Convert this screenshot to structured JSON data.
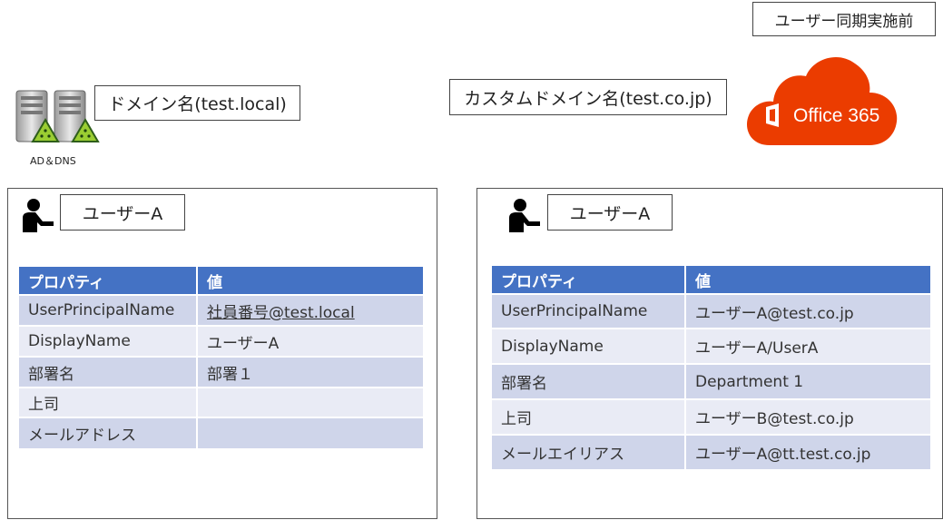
{
  "header": {
    "status_label": "ユーザー同期実施前"
  },
  "onprem": {
    "domain_label": "ドメイン名(test.local)",
    "server_caption": "AD＆DNS",
    "user_label": "ユーザーA",
    "table": {
      "columns": [
        "プロパティ",
        "値"
      ],
      "rows": [
        {
          "prop": "UserPrincipalName",
          "value": "社員番号@test.local"
        },
        {
          "prop": "DisplayName",
          "value": "ユーザーA"
        },
        {
          "prop": "部署名",
          "value": "部署１"
        },
        {
          "prop": "上司",
          "value": ""
        },
        {
          "prop": "メールアドレス",
          "value": ""
        }
      ]
    }
  },
  "cloud": {
    "domain_label": "カスタムドメイン名(test.co.jp)",
    "logo_text": "Office 365",
    "user_label": "ユーザーA",
    "table": {
      "columns": [
        "プロパティ",
        "値"
      ],
      "rows": [
        {
          "prop": "UserPrincipalName",
          "value": "ユーザーA@test.co.jp"
        },
        {
          "prop": "DisplayName",
          "value": "ユーザーA/UserA"
        },
        {
          "prop": "部署名",
          "value": "Department 1"
        },
        {
          "prop": "上司",
          "value": "ユーザーB@test.co.jp"
        },
        {
          "prop": "メールエイリアス",
          "value": "ユーザーA@tt.test.co.jp"
        }
      ]
    }
  },
  "colors": {
    "table_header": "#4472C4",
    "row_odd": "#CFD5EA",
    "row_even": "#E9EBF5",
    "office_red": "#EB3C00",
    "highlight_red": "#E02020",
    "link_blue": "#2F5597"
  }
}
